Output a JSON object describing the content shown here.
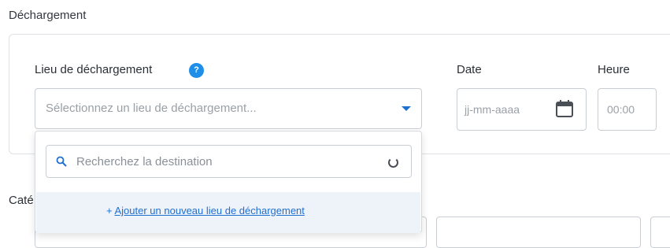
{
  "section": {
    "title": "Déchargement"
  },
  "unloading": {
    "location_label": "Lieu de déchargement",
    "help_icon": "question-icon",
    "help_glyph": "?",
    "location_placeholder": "Sélectionnez un lieu de déchargement...",
    "date_label": "Date",
    "date_placeholder": "jj-mm-aaaa",
    "calendar_icon": "calendar-icon",
    "time_label": "Heure",
    "time_placeholder": "00:00"
  },
  "dropdown": {
    "search_placeholder": "Recherchez la destination",
    "search_icon": "search-icon",
    "loading_icon": "spinner-icon",
    "add_prefix": "+ ",
    "add_label": "Ajouter un nouveau lieu de déchargement"
  },
  "category": {
    "label_visible": "Caté"
  },
  "colors": {
    "accent": "#1f6fd1",
    "help_badge": "#1f8ee8",
    "add_row_bg": "#eef3fa"
  }
}
